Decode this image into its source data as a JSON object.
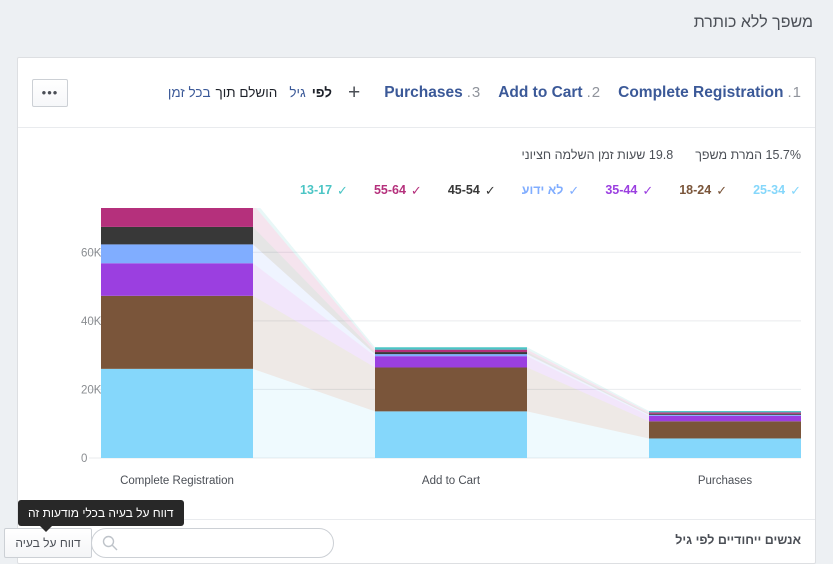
{
  "page_title": "משפך ללא כותרת",
  "toolbar": {
    "steps": [
      {
        "num": "1",
        "label": "Complete Registration"
      },
      {
        "num": "2",
        "label": "Add to Cart"
      },
      {
        "num": "3",
        "label": "Purchases"
      }
    ],
    "add_step_icon": "plus-icon",
    "filters": {
      "by_label": "לפי",
      "breakdown_value": "גיל",
      "completed_within_label": "הושלם תוך",
      "window_value": "בכל זמן"
    },
    "more_button": "•••"
  },
  "stats": [
    {
      "value": "15.7%",
      "label": "המרת משפך"
    },
    {
      "value": "19.8",
      "label": "שעות זמן השלמה חציוני"
    }
  ],
  "legend": [
    {
      "label": "25-34",
      "color": "#85D7FB",
      "checked": true
    },
    {
      "label": "18-24",
      "color": "#7A553A",
      "checked": true
    },
    {
      "label": "35-44",
      "color": "#9B3FE0",
      "checked": true
    },
    {
      "label": "לא ידוע",
      "color": "#80ADFF",
      "checked": true
    },
    {
      "label": "45-54",
      "color": "#383838",
      "checked": true
    },
    {
      "label": "55-64",
      "color": "#B5307C",
      "checked": true
    },
    {
      "label": "13-17",
      "color": "#4BC5C5",
      "checked": true
    }
  ],
  "bottom": {
    "unique_by_age": "אנשים ייחודיים לפי גיל",
    "report_button": "דווח על בעיה",
    "report_tooltip": "דווח על בעיה בכלי מודעות זה",
    "search_placeholder": "",
    "search_value": "",
    "search_icon": "search-icon",
    "globe_icon": "globe-icon"
  },
  "chart_data": {
    "type": "bar",
    "title": "",
    "xlabel": "",
    "ylabel": "",
    "ylim": [
      0,
      70000
    ],
    "yticks": [
      0,
      20000,
      40000,
      60000
    ],
    "ytick_labels": [
      "0",
      "20K",
      "40K",
      "60K"
    ],
    "grid": true,
    "legend_position": "top",
    "stacked": true,
    "categories": [
      "Complete Registration",
      "Add to Cart",
      "Purchases"
    ],
    "series": [
      {
        "name": "25-34",
        "color": "#85D7FB",
        "values": [
          26000,
          13600,
          5700
        ]
      },
      {
        "name": "18-24",
        "color": "#7A553A",
        "values": [
          21300,
          12800,
          5000
        ]
      },
      {
        "name": "35-44",
        "color": "#9B3FE0",
        "values": [
          9500,
          3300,
          1600
        ]
      },
      {
        "name": "לא ידוע",
        "color": "#80ADFF",
        "values": [
          5500,
          600,
          300
        ]
      },
      {
        "name": "45-54",
        "color": "#383838",
        "values": [
          5100,
          600,
          300
        ]
      },
      {
        "name": "55-64",
        "color": "#B5307C",
        "values": [
          6600,
          700,
          400
        ]
      },
      {
        "name": "13-17",
        "color": "#4BC5C5",
        "values": [
          1500,
          700,
          400
        ]
      }
    ],
    "totals": [
      75500,
      32300,
      13700
    ]
  }
}
